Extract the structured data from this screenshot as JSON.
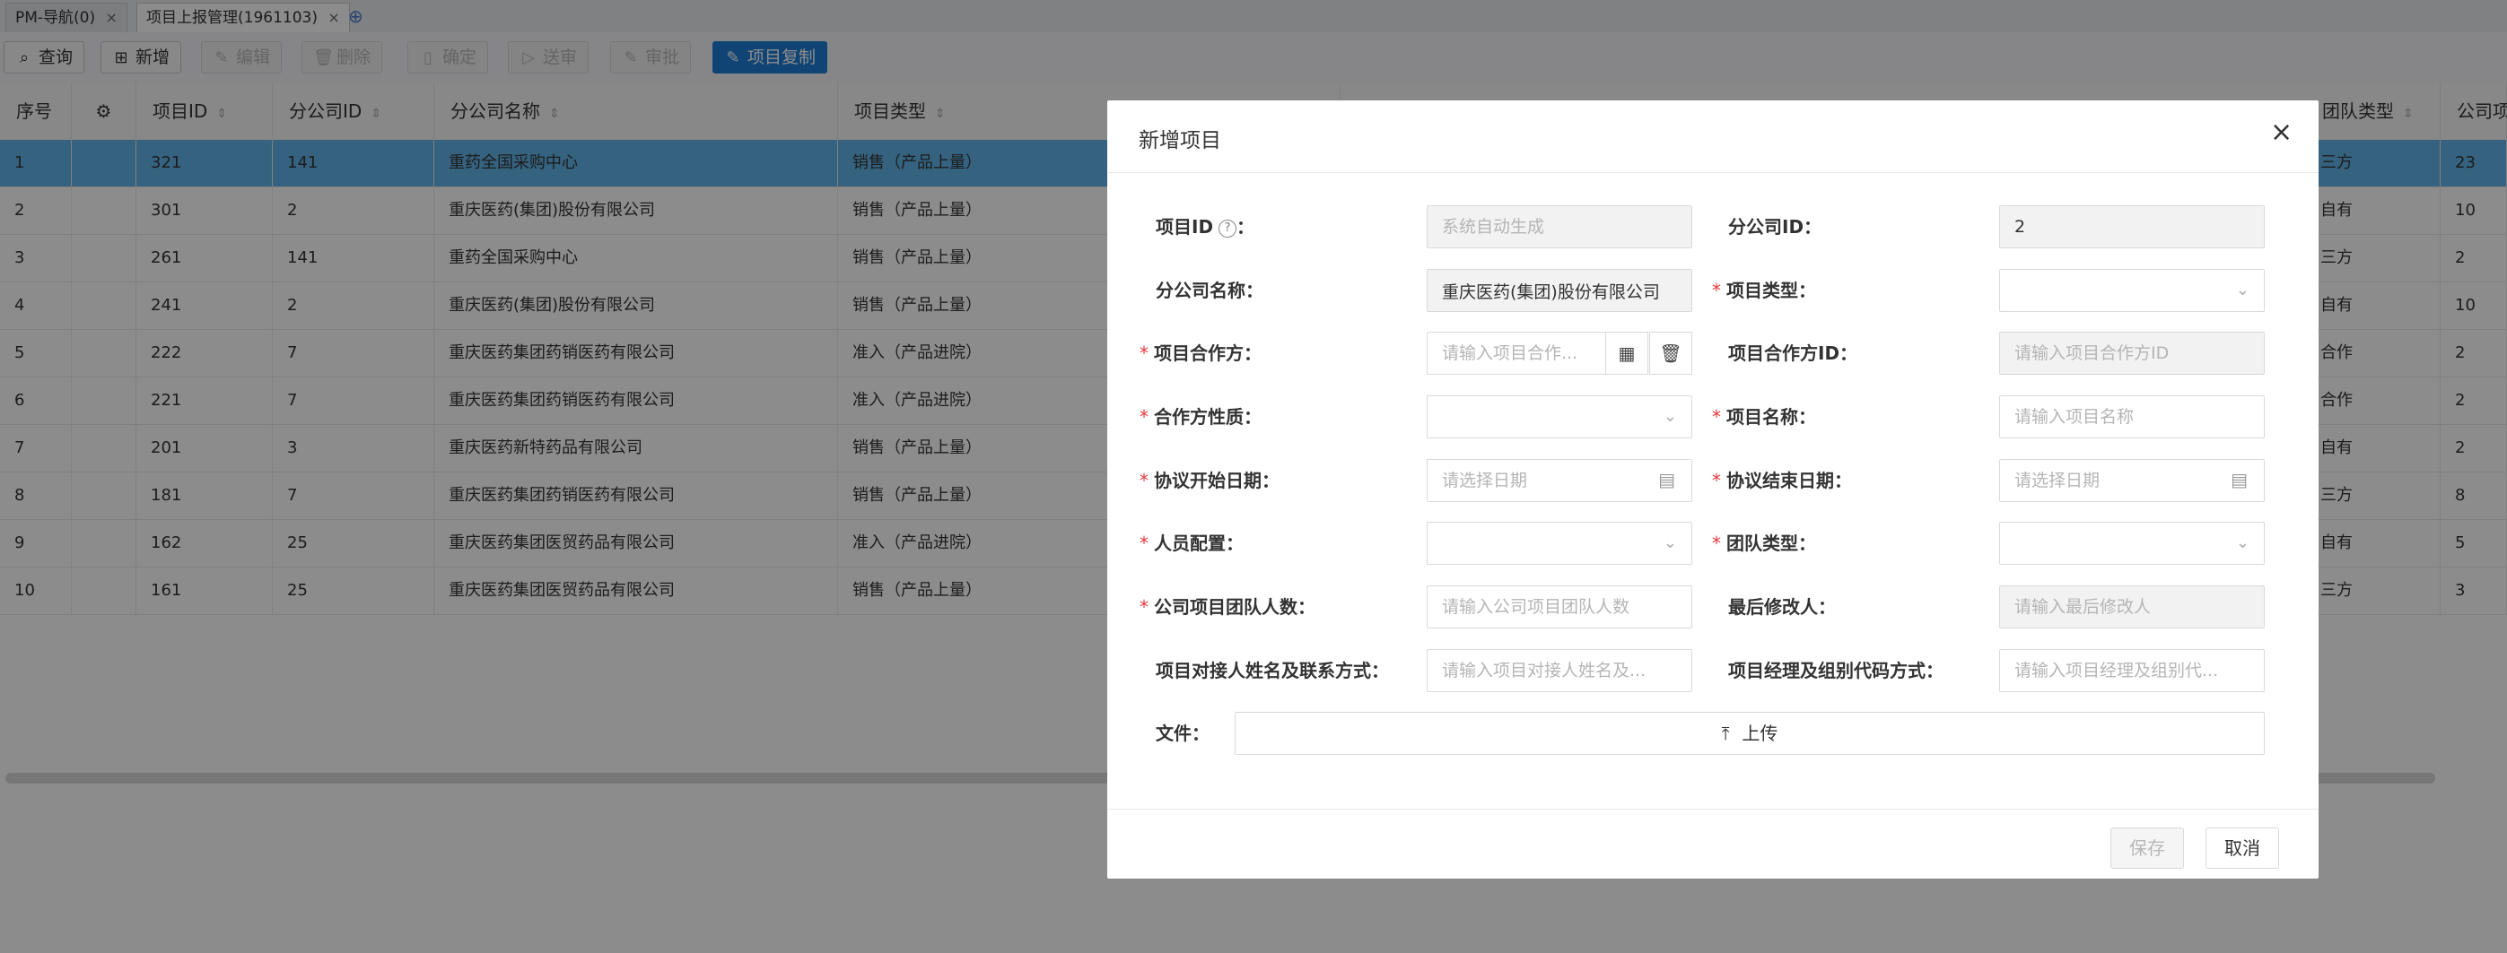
{
  "tabs": [
    {
      "label": "PM-导航(0)",
      "close": "×"
    },
    {
      "label": "项目上报管理(1961103)",
      "close": "×"
    }
  ],
  "tab_add_icon": "plus-circle-icon",
  "toolbar": {
    "query": "查询",
    "add": "新增",
    "edit": "编辑",
    "delete": "删除",
    "confirm": "确定",
    "submit": "送审",
    "approve": "审批",
    "copy": "项目复制"
  },
  "grid": {
    "headers": {
      "seq": "序号",
      "project_id": "项目ID",
      "branch_id": "分公司ID",
      "branch_name": "分公司名称",
      "project_type": "项目类型",
      "team_type": "团队类型",
      "company_project": "公司项"
    },
    "rows": [
      {
        "seq": "1",
        "project_id": "321",
        "branch_id": "141",
        "branch_name": "重药全国采购中心",
        "project_type": "销售（产品上量）",
        "team_type": "三方",
        "count": "23"
      },
      {
        "seq": "2",
        "project_id": "301",
        "branch_id": "2",
        "branch_name": "重庆医药(集团)股份有限公司",
        "project_type": "销售（产品上量）",
        "team_type": "自有",
        "count": "10"
      },
      {
        "seq": "3",
        "project_id": "261",
        "branch_id": "141",
        "branch_name": "重药全国采购中心",
        "project_type": "销售（产品上量）",
        "team_type": "三方",
        "count": "2"
      },
      {
        "seq": "4",
        "project_id": "241",
        "branch_id": "2",
        "branch_name": "重庆医药(集团)股份有限公司",
        "project_type": "销售（产品上量）",
        "team_type": "自有",
        "count": "10"
      },
      {
        "seq": "5",
        "project_id": "222",
        "branch_id": "7",
        "branch_name": "重庆医药集团药销医药有限公司",
        "project_type": "准入（产品进院）",
        "team_type": "合作",
        "count": "2"
      },
      {
        "seq": "6",
        "project_id": "221",
        "branch_id": "7",
        "branch_name": "重庆医药集团药销医药有限公司",
        "project_type": "准入（产品进院）",
        "team_type": "合作",
        "count": "2"
      },
      {
        "seq": "7",
        "project_id": "201",
        "branch_id": "3",
        "branch_name": "重庆医药新特药品有限公司",
        "project_type": "销售（产品上量）",
        "team_type": "自有",
        "count": "2"
      },
      {
        "seq": "8",
        "project_id": "181",
        "branch_id": "7",
        "branch_name": "重庆医药集团药销医药有限公司",
        "project_type": "销售（产品上量）",
        "team_type": "三方",
        "count": "8"
      },
      {
        "seq": "9",
        "project_id": "162",
        "branch_id": "25",
        "branch_name": "重庆医药集团医贸药品有限公司",
        "project_type": "准入（产品进院）",
        "team_type": "自有",
        "count": "5"
      },
      {
        "seq": "10",
        "project_id": "161",
        "branch_id": "25",
        "branch_name": "重庆医药集团医贸药品有限公司",
        "project_type": "销售（产品上量）",
        "team_type": "三方",
        "count": "3"
      }
    ]
  },
  "modal": {
    "title": "新增项目",
    "close": "×",
    "labels": {
      "project_id": "项目ID",
      "branch_id": "分公司ID：",
      "branch_name": "分公司名称：",
      "project_type": "项目类型：",
      "partner": "项目合作方：",
      "partner_id": "项目合作方ID：",
      "partner_nature": "合作方性质：",
      "project_name": "项目名称：",
      "start_date": "协议开始日期：",
      "end_date": "协议结束日期：",
      "staffing": "人员配置：",
      "team_type": "团队类型：",
      "team_count": "公司项目团队人数：",
      "last_modifier": "最后修改人：",
      "contact": "项目对接人姓名及联系方式：",
      "manager": "项目经理及组别代码方式：",
      "file": "文件："
    },
    "label_suffix": "：",
    "required_mark": "*",
    "help_mark": "?",
    "values": {
      "project_id_placeholder": "系统自动生成",
      "branch_id": "2",
      "branch_name": "重庆医药(集团)股份有限公司"
    },
    "placeholders": {
      "partner": "请输入项目合作...",
      "partner_id": "请输入项目合作方ID",
      "project_name": "请输入项目名称",
      "start_date": "请选择日期",
      "end_date": "请选择日期",
      "team_count": "请输入公司项目团队人数",
      "last_modifier": "请输入最后修改人",
      "contact": "请输入项目对接人姓名及...",
      "manager": "请输入项目经理及组别代..."
    },
    "upload_label": "上传",
    "save": "保存",
    "cancel": "取消"
  }
}
